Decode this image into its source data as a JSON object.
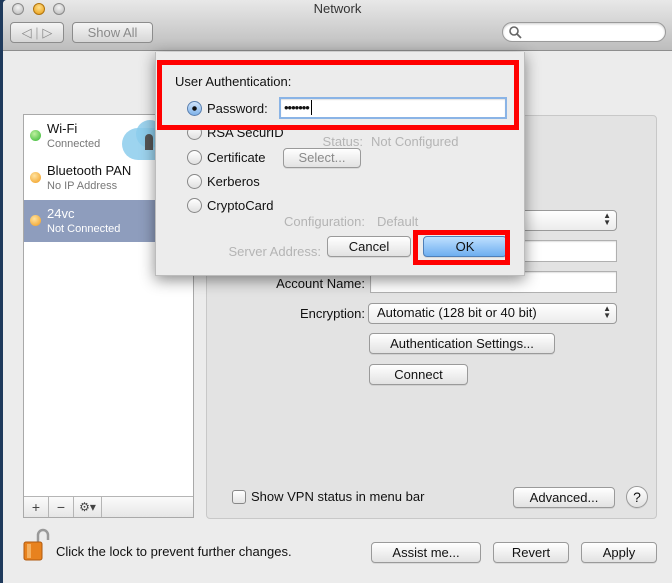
{
  "window": {
    "title": "Network"
  },
  "toolbar": {
    "back_icon": "chevron-left-icon",
    "forward_icon": "chevron-right-icon",
    "show_all_label": "Show All",
    "search_placeholder": ""
  },
  "services": [
    {
      "name": "Wi-Fi",
      "status": "Connected",
      "status_color": "#2fb52f"
    },
    {
      "name": "Bluetooth PAN",
      "status": "No IP Address",
      "status_color": "#f09a1a"
    },
    {
      "name": "24vc",
      "status": "Not Connected",
      "status_color": "#f09a1a",
      "selected": true
    }
  ],
  "list_toolbar": {
    "add": "+",
    "remove": "−",
    "gear": "⚙▾"
  },
  "detail": {
    "status_label": "Status:",
    "status_value": "Not Configured",
    "configuration_label": "Configuration:",
    "configuration_value": "Default",
    "server_label": "Server Address:",
    "server_value": "",
    "account_label": "Account Name:",
    "account_value": "",
    "encryption_label": "Encryption:",
    "encryption_value": "Automatic (128 bit or 40 bit)",
    "auth_settings_label": "Authentication Settings...",
    "connect_label": "Connect",
    "show_vpn_label": "Show VPN status in menu bar",
    "show_vpn_checked": false,
    "advanced_label": "Advanced...",
    "help_label": "?"
  },
  "footer": {
    "lock_text": "Click the lock to prevent further changes.",
    "assist_label": "Assist me...",
    "revert_label": "Revert",
    "apply_label": "Apply"
  },
  "sheet": {
    "heading": "User Authentication:",
    "options": [
      {
        "label": "Password:",
        "selected": true
      },
      {
        "label": "RSA SecurID",
        "selected": false
      },
      {
        "label": "Certificate",
        "selected": false
      },
      {
        "label": "Kerberos",
        "selected": false
      },
      {
        "label": "CryptoCard",
        "selected": false
      }
    ],
    "password_value": "•••••••",
    "select_label": "Select...",
    "cancel_label": "Cancel",
    "ok_label": "OK"
  },
  "watermark": {
    "text": "24vc"
  },
  "colors": {
    "highlight": "#ff0000",
    "selection": "#8e9dbd",
    "default_button": "#6eaef0"
  }
}
